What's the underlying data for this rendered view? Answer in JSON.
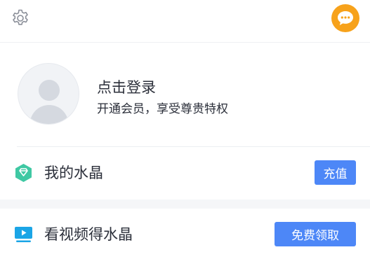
{
  "header": {
    "settings_icon": "gear-icon",
    "message_icon": "chat-bubble-icon",
    "message_color": "#f7a21b"
  },
  "profile": {
    "avatar_icon": "default-user-avatar",
    "login_title": "点击登录",
    "login_subtitle": "开通会员，享受尊贵特权"
  },
  "crystal_row": {
    "icon": "gem-icon",
    "icon_color": "#3fc8a3",
    "label": "我的水晶",
    "button_label": "充值"
  },
  "video_row": {
    "icon": "video-screen-icon",
    "icon_color": "#1ba5e6",
    "label": "看视频得水晶",
    "button_label": "免费领取"
  },
  "colors": {
    "accent": "#4d87f7",
    "text": "#2b2f3a"
  }
}
